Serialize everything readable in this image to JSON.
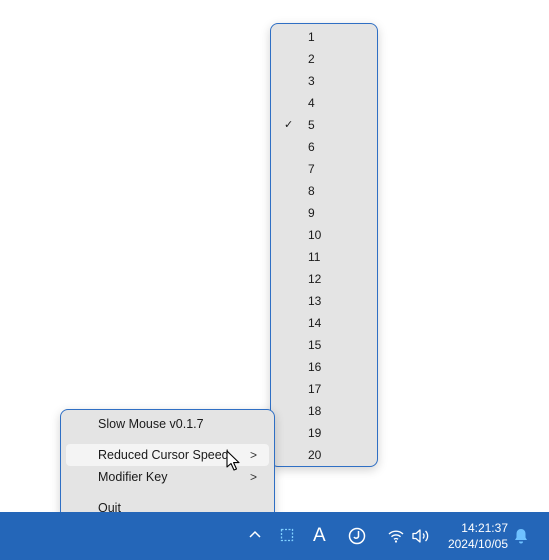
{
  "speed_menu": {
    "items": [
      "1",
      "2",
      "3",
      "4",
      "5",
      "6",
      "7",
      "8",
      "9",
      "10",
      "11",
      "12",
      "13",
      "14",
      "15",
      "16",
      "17",
      "18",
      "19",
      "20"
    ],
    "checked": "5",
    "check_glyph": "✓"
  },
  "main_menu": {
    "title": "Slow Mouse v0.1.7",
    "reduced_speed": "Reduced Cursor Speed",
    "modifier_key": "Modifier Key",
    "quit": "Quit",
    "submenu_arrow": ">"
  },
  "taskbar": {
    "ime_label": "A",
    "time": "14:21:37",
    "date": "2024/10/05",
    "icons": [
      "chevron-up-icon",
      "slow-mouse-tray-icon",
      "ime-mode-icon",
      "ime-circle-icon",
      "wifi-icon",
      "volume-icon",
      "notification-bell-icon"
    ],
    "colors": {
      "taskbar_bg": "#2466b8",
      "menu_border": "#2f6fc4",
      "menu_bg": "#e4e4e4"
    }
  }
}
